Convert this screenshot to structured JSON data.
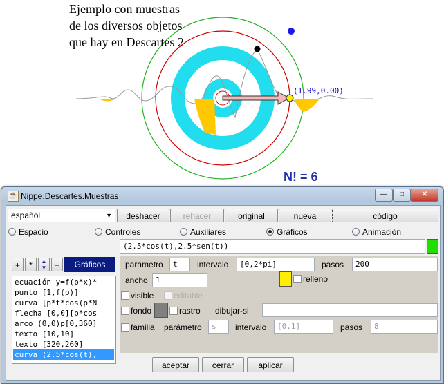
{
  "scene": {
    "caption_lines": [
      "Ejemplo con muestras",
      "de los diversos objetos",
      "que hay en Descartes 2"
    ],
    "coord_label": "(1.99,0.00)",
    "factorial_label": "N! = 6",
    "colors": {
      "green": "#22b022",
      "red": "#cc0000",
      "cyan": "#22ddee",
      "yellow": "#ffc800",
      "arrow": "#f4b8b8",
      "blue_point": "#1a1aee"
    }
  },
  "window": {
    "title": "Nippe.Descartes.Muestras",
    "controls": {
      "minimize": "—",
      "maximize": "□",
      "close": "✕"
    }
  },
  "toolbar": {
    "language": "español",
    "buttons": [
      {
        "label": "deshacer",
        "enabled": true
      },
      {
        "label": "rehacer",
        "enabled": false
      },
      {
        "label": "original",
        "enabled": true
      },
      {
        "label": "nueva",
        "enabled": true
      },
      {
        "label": "código",
        "enabled": true
      }
    ]
  },
  "tabs": [
    {
      "label": "Espacio",
      "selected": false
    },
    {
      "label": "Controles",
      "selected": false
    },
    {
      "label": "Auxiliares",
      "selected": false
    },
    {
      "label": "Gráficos",
      "selected": true
    },
    {
      "label": "Animación",
      "selected": false
    }
  ],
  "list_panel": {
    "buttons": [
      "+",
      "*",
      "−"
    ],
    "header": "Gráficos",
    "items": [
      "ecuación y=f(p*x)*",
      "punto [1,f(p)]",
      "curva [p*t*cos(p*N",
      "flecha [0,0][p*cos",
      "arco (0,0)p[0,360]",
      "texto [10,10]",
      "texto [320,260]",
      "curva (2.5*cos(t),"
    ],
    "selected_index": 7
  },
  "editor": {
    "expression": "(2.5*cos(t),2.5*sen(t))",
    "expr_color": "#22dd00",
    "parametro_label": "parámetro",
    "parametro_value": "t",
    "intervalo_label": "intervalo",
    "intervalo_value": "[0,2*pi]",
    "pasos_label": "pasos",
    "pasos_value": "200",
    "ancho_label": "ancho",
    "ancho_value": "1",
    "fill_color": "#ffee00",
    "relleno_label": "relleno",
    "visible_label": "visible",
    "editable_label": "editable",
    "fondo_label": "fondo",
    "fondo_color": "#808080",
    "rastro_label": "rastro",
    "dibujar_si_label": "dibujar-si",
    "dibujar_si_value": "",
    "familia_label": "familia",
    "fam_parametro_label": "parámetro",
    "fam_parametro_value": "s",
    "fam_intervalo_label": "intervalo",
    "fam_intervalo_value": "[0,1]",
    "fam_pasos_label": "pasos",
    "fam_pasos_value": "8"
  },
  "footer": {
    "aceptar": "aceptar",
    "cerrar": "cerrar",
    "aplicar": "aplicar"
  }
}
